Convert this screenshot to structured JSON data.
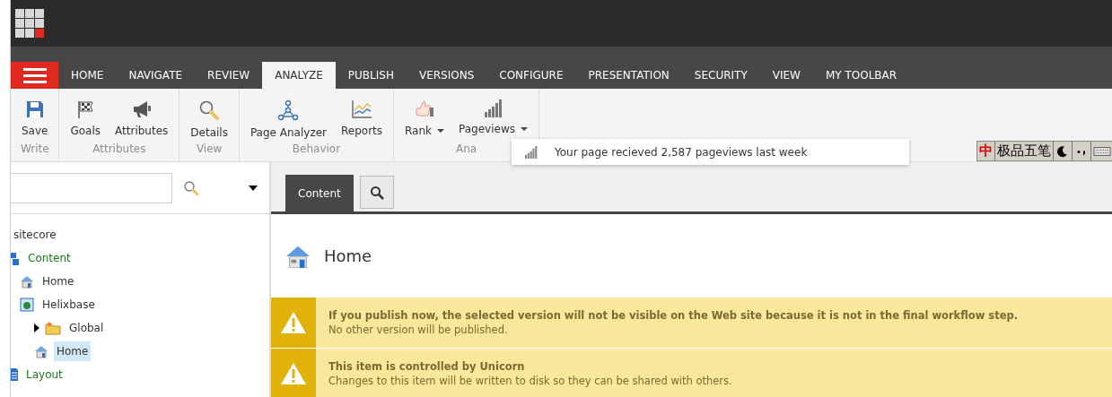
{
  "menu_tabs": [
    {
      "label": "HOME",
      "selected": false
    },
    {
      "label": "NAVIGATE",
      "selected": false
    },
    {
      "label": "REVIEW",
      "selected": false
    },
    {
      "label": "ANALYZE",
      "selected": true
    },
    {
      "label": "PUBLISH",
      "selected": false
    },
    {
      "label": "VERSIONS",
      "selected": false
    },
    {
      "label": "CONFIGURE",
      "selected": false
    },
    {
      "label": "PRESENTATION",
      "selected": false
    },
    {
      "label": "SECURITY",
      "selected": false
    },
    {
      "label": "VIEW",
      "selected": false
    },
    {
      "label": "MY TOOLBAR",
      "selected": false
    }
  ],
  "ribbon_groups": [
    {
      "label": "Write",
      "buttons": [
        {
          "label": "Save",
          "kind": "save"
        }
      ]
    },
    {
      "label": "Attributes",
      "buttons": [
        {
          "label": "Goals",
          "kind": "flag"
        },
        {
          "label": "Attributes",
          "kind": "megaphone"
        }
      ]
    },
    {
      "label": "View",
      "buttons": [
        {
          "label": "Details",
          "kind": "magnifier"
        }
      ]
    },
    {
      "label": "Behavior",
      "buttons": [
        {
          "label": "Page Analyzer",
          "kind": "nodes"
        },
        {
          "label": "Reports",
          "kind": "chart"
        }
      ]
    },
    {
      "label": "Ana",
      "buttons": [
        {
          "label": "Rank",
          "kind": "thumb",
          "dropdown": true
        },
        {
          "label": "Pageviews",
          "kind": "bars",
          "dropdown": true
        }
      ]
    }
  ],
  "pageviews_popup": {
    "text": "Your page recieved 2,587 pageviews last week"
  },
  "ime_bar": {
    "mode": "中",
    "name": "极品五笔"
  },
  "tree": [
    {
      "label": "sitecore",
      "children": [
        {
          "label": "Content",
          "kind": "content",
          "children": [
            {
              "label": "Home",
              "kind": "home",
              "selected": false
            },
            {
              "label": "Helixbase",
              "kind": "site",
              "selected": false,
              "children": [
                {
                  "label": "Global",
                  "kind": "folder",
                  "selected": false,
                  "expanded": false
                },
                {
                  "label": "Home",
                  "kind": "home",
                  "selected": true
                }
              ]
            }
          ]
        },
        {
          "label": "Layout",
          "kind": "layout"
        }
      ]
    }
  ],
  "editor_tabs": [
    {
      "label": "Content",
      "selected": true
    }
  ],
  "item_title": "Home",
  "warnings": [
    {
      "title": "If you publish now, the selected version will not be visible on the Web site because it is not in the final workflow step.",
      "text": "No other version will be published."
    },
    {
      "title": "This item is controlled by Unicorn",
      "text": "Changes to this item will be written to disk so they can be shared with others."
    }
  ]
}
